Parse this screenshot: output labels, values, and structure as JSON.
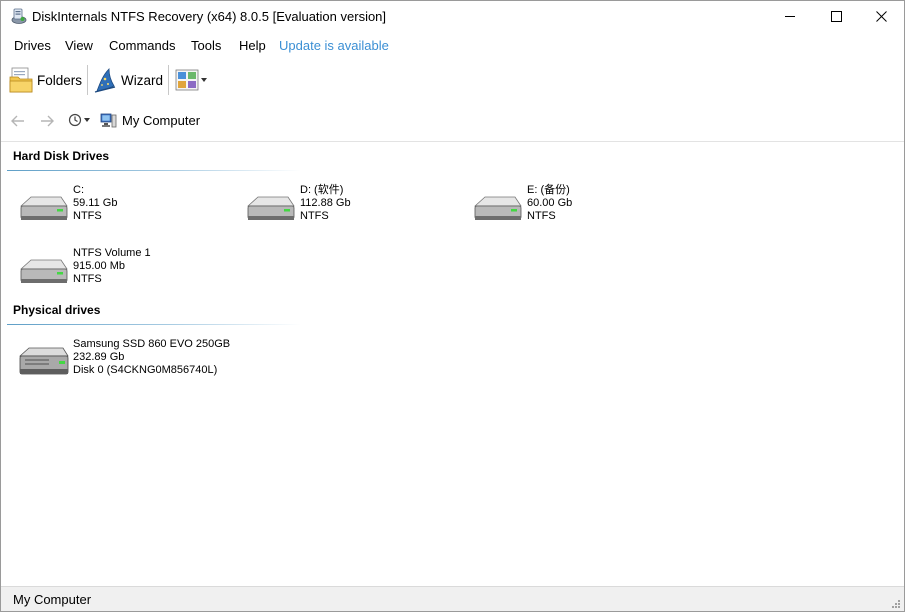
{
  "window": {
    "title": "DiskInternals NTFS Recovery (x64) 8.0.5 [Evaluation version]",
    "controls": {
      "minimize": "minimize-icon",
      "maximize": "maximize-icon",
      "close": "close-icon"
    }
  },
  "menu": {
    "items": [
      "Drives",
      "View",
      "Commands",
      "Tools",
      "Help"
    ],
    "update_label": "Update is available",
    "update_color": "#3b8fd4"
  },
  "toolbar": {
    "folders_label": "Folders",
    "wizard_label": "Wizard",
    "view_mode_icon": "view-mode-icon"
  },
  "navigation": {
    "back_icon": "back-arrow-icon",
    "forward_icon": "forward-arrow-icon",
    "history_icon": "history-icon",
    "location": "My Computer"
  },
  "sections": {
    "hard_disks": {
      "title": "Hard Disk Drives",
      "drives": [
        {
          "name": "C:",
          "size": "59.11 Gb",
          "fs": "NTFS"
        },
        {
          "name": "D: (软件)",
          "size": "112.88 Gb",
          "fs": "NTFS"
        },
        {
          "name": "E: (备份)",
          "size": "60.00 Gb",
          "fs": "NTFS"
        },
        {
          "name": "NTFS Volume 1",
          "size": "915.00 Mb",
          "fs": "NTFS"
        }
      ]
    },
    "physical": {
      "title": "Physical drives",
      "drives": [
        {
          "name": "Samsung SSD 860 EVO 250GB",
          "size": "232.89 Gb",
          "fs": "Disk 0 (S4CKNG0M856740L)"
        }
      ]
    }
  },
  "status": {
    "text": "My Computer"
  },
  "colors": {
    "section_line": "#5f9fc7",
    "status_bg": "#f0f0f0"
  }
}
